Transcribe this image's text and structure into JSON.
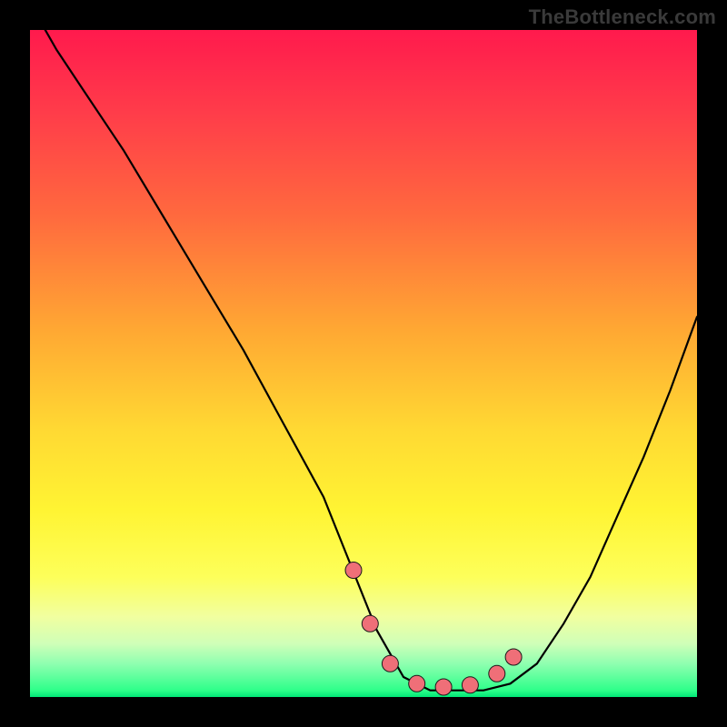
{
  "watermark": {
    "text": "TheBottleneck.com"
  },
  "colors": {
    "background": "#000000",
    "curve_stroke": "#000000",
    "marker_fill": "#ef6f78",
    "marker_stroke": "#1a1a1a",
    "gradient_top": "#ff1a4d",
    "gradient_bottom": "#00e676"
  },
  "chart_data": {
    "type": "line",
    "title": "",
    "xlabel": "",
    "ylabel": "",
    "xlim": [
      0,
      100
    ],
    "ylim": [
      0,
      100
    ],
    "grid": false,
    "series": [
      {
        "name": "bottleneck-curve",
        "x": [
          0,
          4,
          8,
          14,
          20,
          26,
          32,
          38,
          44,
          48,
          52,
          56,
          60,
          64,
          68,
          72,
          76,
          80,
          84,
          88,
          92,
          96,
          100
        ],
        "y": [
          104,
          97,
          91,
          82,
          72,
          62,
          52,
          41,
          30,
          20,
          10,
          3,
          1,
          1,
          1,
          2,
          5,
          11,
          18,
          27,
          36,
          46,
          57
        ]
      }
    ],
    "markers": {
      "name": "highlight-points",
      "x": [
        48.5,
        51.0,
        54.0,
        58.0,
        62.0,
        66.0,
        70.0,
        72.5
      ],
      "y": [
        19.0,
        11.0,
        5.0,
        2.0,
        1.5,
        1.8,
        3.5,
        6.0
      ]
    }
  }
}
